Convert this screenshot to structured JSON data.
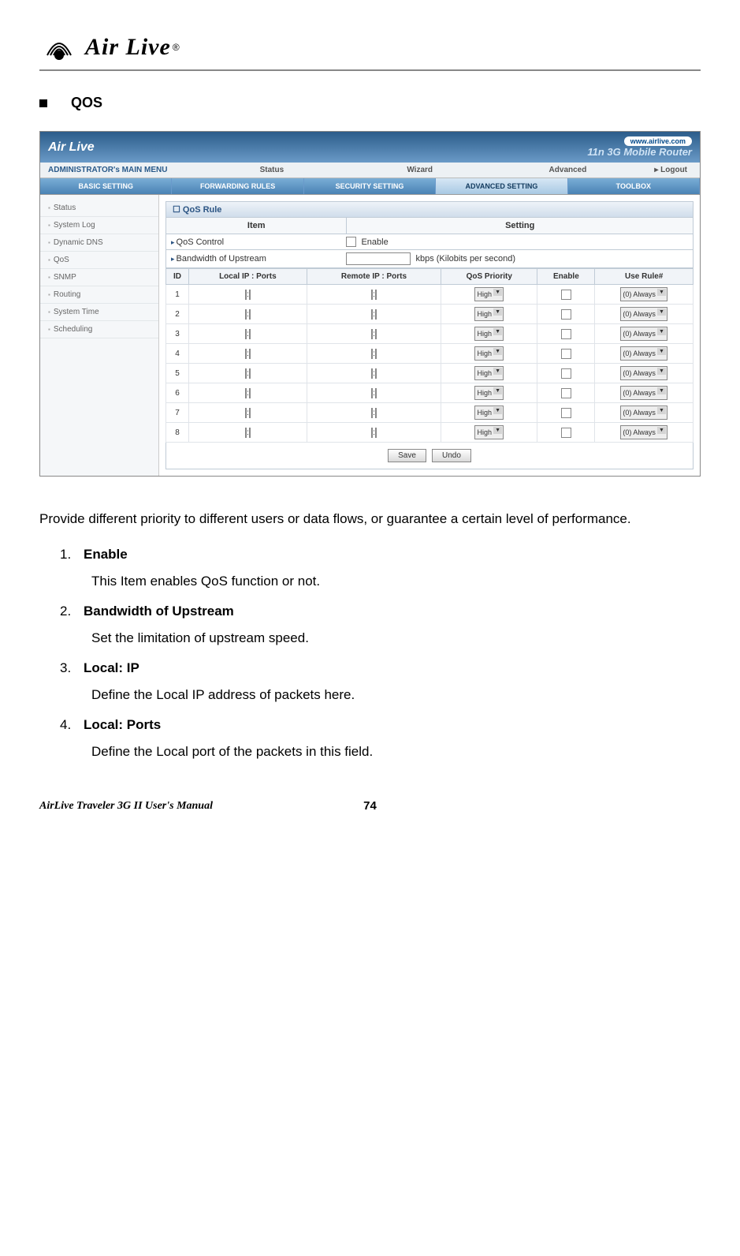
{
  "logo": {
    "text": "Air Live",
    "sup": "®"
  },
  "section_title": "QOS",
  "screenshot": {
    "top_brand": "Air Live",
    "top_url": "www.airlive.com",
    "top_subtitle": "11n 3G Mobile Router",
    "menu_main": "ADMINISTRATOR's MAIN MENU",
    "menu_items": [
      "Status",
      "Wizard",
      "Advanced"
    ],
    "menu_logout": "▸ Logout",
    "tabs": [
      "BASIC SETTING",
      "FORWARDING RULES",
      "SECURITY SETTING",
      "ADVANCED SETTING",
      "TOOLBOX"
    ],
    "selected_tab_index": 3,
    "sidebar": [
      "Status",
      "System Log",
      "Dynamic DNS",
      "QoS",
      "SNMP",
      "Routing",
      "System Time",
      "Scheduling"
    ],
    "panel_title": "QoS Rule",
    "col_item": "Item",
    "col_setting": "Setting",
    "row_qos_label": "QoS Control",
    "row_qos_enable": "Enable",
    "row_bw_label": "Bandwidth of Upstream",
    "row_bw_unit": "kbps (Kilobits per second)",
    "table_headers": [
      "ID",
      "Local IP : Ports",
      "Remote IP : Ports",
      "QoS Priority",
      "Enable",
      "Use Rule#"
    ],
    "priority_default": "High",
    "rule_default": "(0) Always",
    "row_count": 8,
    "btn_save": "Save",
    "btn_undo": "Undo"
  },
  "description": "Provide different priority to different users or data flows, or guarantee a certain level of performance.",
  "items": [
    {
      "num": "1.",
      "label": "Enable",
      "desc": "This Item enables QoS function or not."
    },
    {
      "num": "2.",
      "label": "Bandwidth of Upstream",
      "desc": "Set the limitation of upstream speed."
    },
    {
      "num": "3.",
      "label": "Local: IP",
      "desc": "Define the Local IP address of packets here."
    },
    {
      "num": "4.",
      "label": "Local: Ports",
      "desc": "Define the Local port of the packets in this field."
    }
  ],
  "footer": {
    "title": "AirLive Traveler 3G II User's Manual",
    "page": "74"
  }
}
